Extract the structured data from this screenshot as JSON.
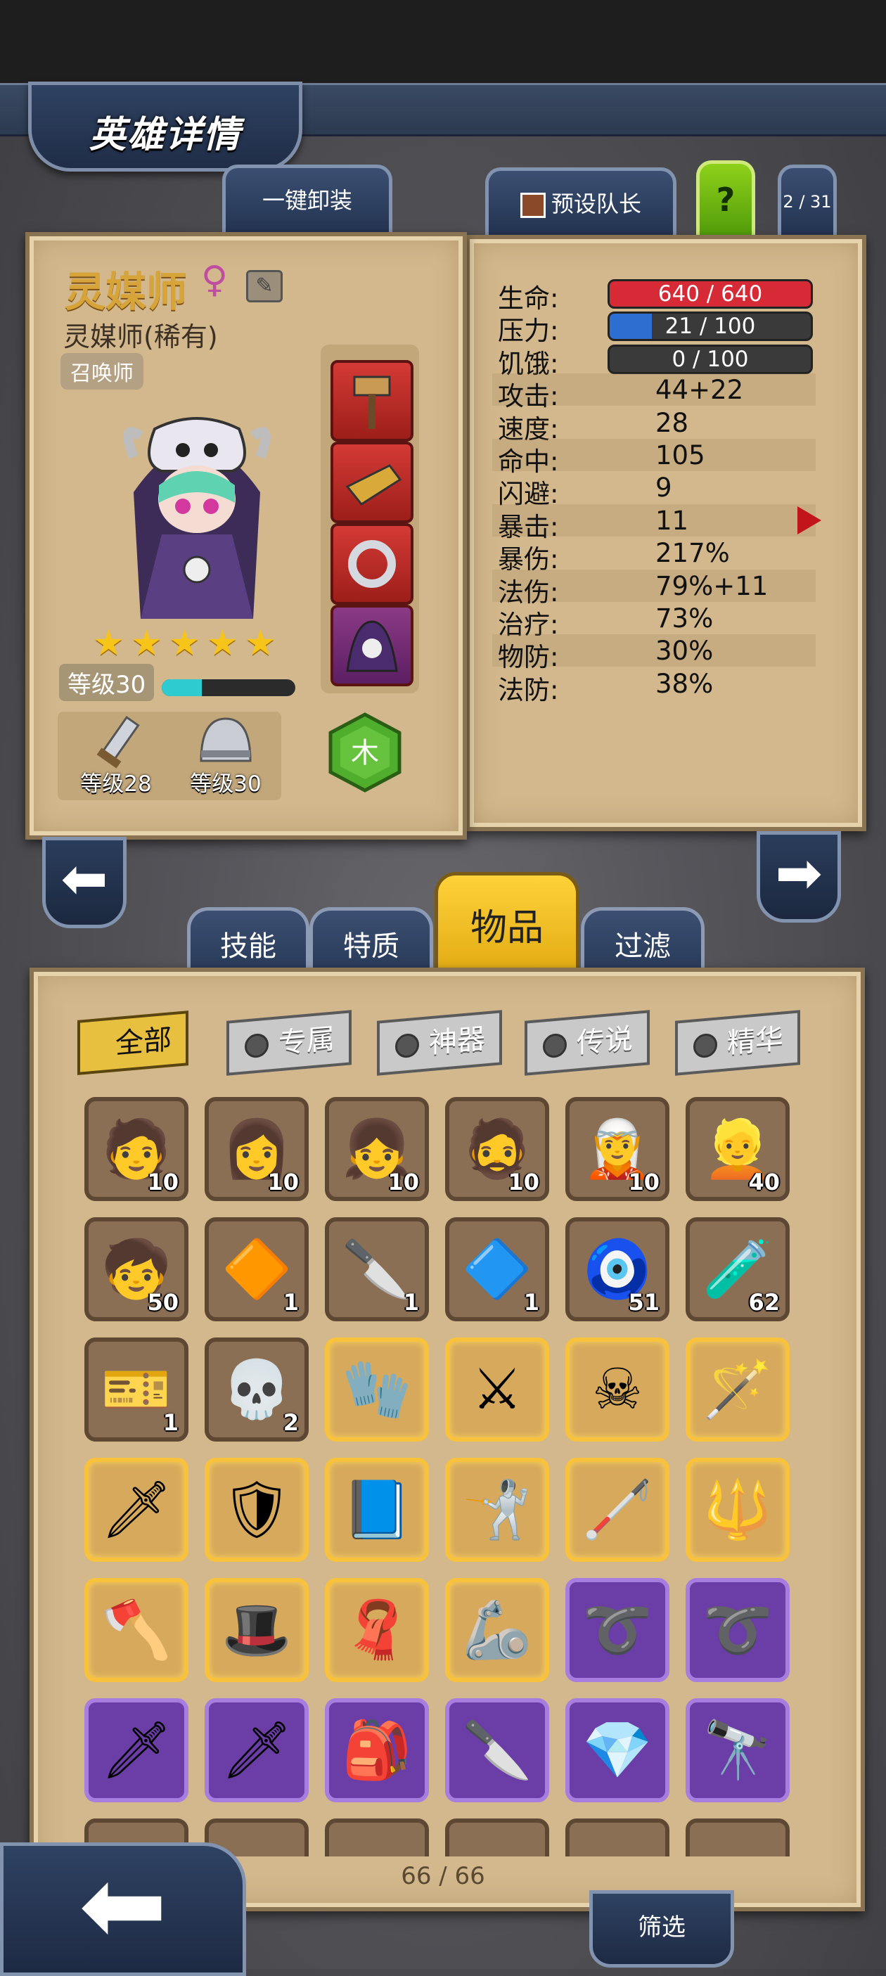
{
  "header": {
    "title": "英雄详情"
  },
  "top_buttons": {
    "unequip_all": "一键卸装",
    "preset_leader": "预设队长",
    "help": "?",
    "hero_index": "2 / 31"
  },
  "hero": {
    "name": "灵媒师",
    "gender_symbol": "♀",
    "full_name": "灵媒师(稀有)",
    "class": "召唤师",
    "stars": 5,
    "level": "等级30",
    "xp_fraction": 0.3,
    "weapon_level": "等级28",
    "armor_level": "等级30",
    "element": "木"
  },
  "stats": [
    {
      "label": "生命:",
      "value": "640 / 640",
      "bar": true,
      "fill": 1.0,
      "color": "#d62a36"
    },
    {
      "label": "压力:",
      "value": "21 / 100",
      "bar": true,
      "fill": 0.21,
      "color": "#2d6fd1"
    },
    {
      "label": "饥饿:",
      "value": "0 / 100",
      "bar": true,
      "fill": 0.0,
      "color": "#e9a430"
    },
    {
      "label": "攻击:",
      "value": "44+22"
    },
    {
      "label": "速度:",
      "value": "28"
    },
    {
      "label": "命中:",
      "value": "105"
    },
    {
      "label": "闪避:",
      "value": "9"
    },
    {
      "label": "暴击:",
      "value": "11"
    },
    {
      "label": "暴伤:",
      "value": "217%"
    },
    {
      "label": "法伤:",
      "value": "79%+11"
    },
    {
      "label": "治疗:",
      "value": "73%"
    },
    {
      "label": "物防:",
      "value": "30%"
    },
    {
      "label": "法防:",
      "value": "38%"
    }
  ],
  "category_tabs": [
    "技能",
    "特质",
    "物品",
    "过滤"
  ],
  "active_category": "物品",
  "filter_tags": [
    "全部",
    "专属",
    "神器",
    "传说",
    "精华"
  ],
  "active_filter": "全部",
  "items": [
    {
      "type": "common",
      "icon": "hero-portrait-icon",
      "glyph": "🧑",
      "count": "10"
    },
    {
      "type": "common",
      "icon": "hero-portrait-icon",
      "glyph": "👩",
      "count": "10"
    },
    {
      "type": "common",
      "icon": "hero-portrait-icon",
      "glyph": "👧",
      "count": "10"
    },
    {
      "type": "common",
      "icon": "hero-portrait-icon",
      "glyph": "🧔",
      "count": "10"
    },
    {
      "type": "common",
      "icon": "hero-portrait-icon",
      "glyph": "🧝",
      "count": "10"
    },
    {
      "type": "common",
      "icon": "hero-portrait-icon",
      "glyph": "👱",
      "count": "40"
    },
    {
      "type": "common",
      "icon": "hero-portrait-icon",
      "glyph": "🧒",
      "count": "50"
    },
    {
      "type": "common",
      "icon": "rune-gem-icon",
      "glyph": "🔶",
      "count": "1"
    },
    {
      "type": "common",
      "icon": "chisel-icon",
      "glyph": "🔪",
      "count": "1"
    },
    {
      "type": "common",
      "icon": "crystal-powder-icon",
      "glyph": "🔷",
      "count": "1"
    },
    {
      "type": "common",
      "icon": "eye-token-icon",
      "glyph": "🧿",
      "count": "51"
    },
    {
      "type": "common",
      "icon": "potion-icon",
      "glyph": "🧪",
      "count": "62"
    },
    {
      "type": "common",
      "icon": "ticket-icon",
      "glyph": "🎫",
      "count": "1"
    },
    {
      "type": "common",
      "icon": "skull-doll-icon",
      "glyph": "💀",
      "count": "2"
    },
    {
      "type": "gold",
      "icon": "dark-gauntlet-icon",
      "glyph": "🧤",
      "count": ""
    },
    {
      "type": "gold",
      "icon": "crossed-daggers-icon",
      "glyph": "⚔",
      "count": ""
    },
    {
      "type": "gold",
      "icon": "reaper-cloak-icon",
      "glyph": "☠",
      "count": ""
    },
    {
      "type": "gold",
      "icon": "dark-staff-icon",
      "glyph": "🪄",
      "count": ""
    },
    {
      "type": "gold",
      "icon": "fire-sword-icon",
      "glyph": "🗡",
      "count": ""
    },
    {
      "type": "gold",
      "icon": "armor-icon",
      "glyph": "🛡",
      "count": ""
    },
    {
      "type": "gold",
      "icon": "spellbook-icon",
      "glyph": "📘",
      "count": ""
    },
    {
      "type": "gold",
      "icon": "rapier-icon",
      "glyph": "🤺",
      "count": ""
    },
    {
      "type": "gold",
      "icon": "black-cane-icon",
      "glyph": "🦯",
      "count": ""
    },
    {
      "type": "gold",
      "icon": "crystal-staff-icon",
      "glyph": "🔱",
      "count": ""
    },
    {
      "type": "gold",
      "icon": "battle-axe-icon",
      "glyph": "🪓",
      "count": ""
    },
    {
      "type": "gold",
      "icon": "wizard-hat-icon",
      "glyph": "🎩",
      "count": ""
    },
    {
      "type": "gold",
      "icon": "red-scarf-icon",
      "glyph": "🧣",
      "count": ""
    },
    {
      "type": "gold",
      "icon": "claw-gauntlet-icon",
      "glyph": "🦾",
      "count": ""
    },
    {
      "type": "purple",
      "icon": "whip-icon",
      "glyph": "➰",
      "count": ""
    },
    {
      "type": "purple",
      "icon": "whip-icon",
      "glyph": "➰",
      "count": ""
    },
    {
      "type": "purple",
      "icon": "ice-sword-icon",
      "glyph": "🗡",
      "count": ""
    },
    {
      "type": "purple",
      "icon": "ice-sword-icon",
      "glyph": "🗡",
      "count": ""
    },
    {
      "type": "purple",
      "icon": "backpack-icon",
      "glyph": "🎒",
      "count": ""
    },
    {
      "type": "purple",
      "icon": "poison-dagger-icon",
      "glyph": "🔪",
      "count": ""
    },
    {
      "type": "purple",
      "icon": "gem-scepter-icon",
      "glyph": "💎",
      "count": ""
    },
    {
      "type": "purple",
      "icon": "spyglass-icon",
      "glyph": "🔭",
      "count": ""
    },
    {
      "type": "common",
      "icon": "item-icon",
      "glyph": "",
      "count": ""
    },
    {
      "type": "common",
      "icon": "item-icon",
      "glyph": "",
      "count": ""
    },
    {
      "type": "common",
      "icon": "item-icon",
      "glyph": "",
      "count": ""
    },
    {
      "type": "common",
      "icon": "item-icon",
      "glyph": "",
      "count": ""
    },
    {
      "type": "common",
      "icon": "item-icon",
      "glyph": "",
      "count": ""
    },
    {
      "type": "common",
      "icon": "item-icon",
      "glyph": "",
      "count": ""
    }
  ],
  "footer": {
    "page_count": "66 / 66",
    "filter_button": "筛选"
  }
}
